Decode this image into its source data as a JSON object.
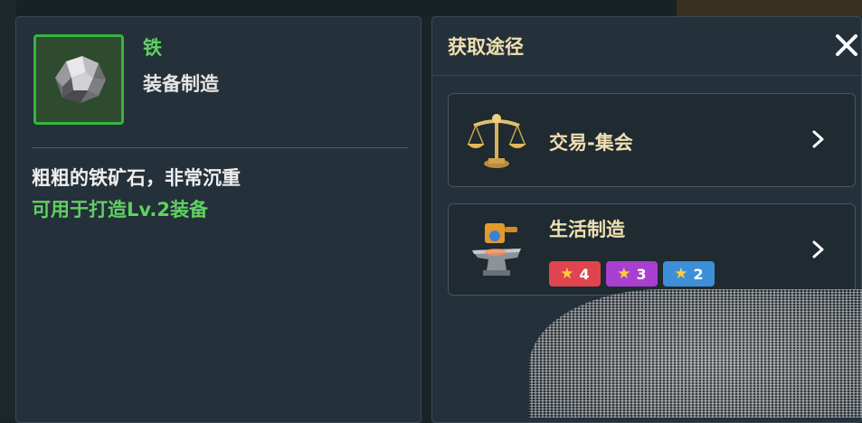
{
  "item": {
    "name": "铁",
    "category": "装备制造",
    "description": "粗粗的铁矿石，非常沉重",
    "usage": "可用于打造Lv.2装备",
    "icon": "iron-ore-icon"
  },
  "sources": {
    "title": "获取途径",
    "close_icon": "close-icon",
    "routes": [
      {
        "label": "交易-集会",
        "icon": "scales-icon"
      },
      {
        "label": "生活制造",
        "icon": "anvil-icon",
        "badges": [
          {
            "value": "4",
            "color": "#e0454f"
          },
          {
            "value": "3",
            "color": "#a83fcf"
          },
          {
            "value": "2",
            "color": "#3d8fd9"
          }
        ]
      }
    ]
  },
  "colors": {
    "accent_green": "#5fd15f",
    "title_gold": "#f0dfb0",
    "panel_bg": "#24303a"
  }
}
